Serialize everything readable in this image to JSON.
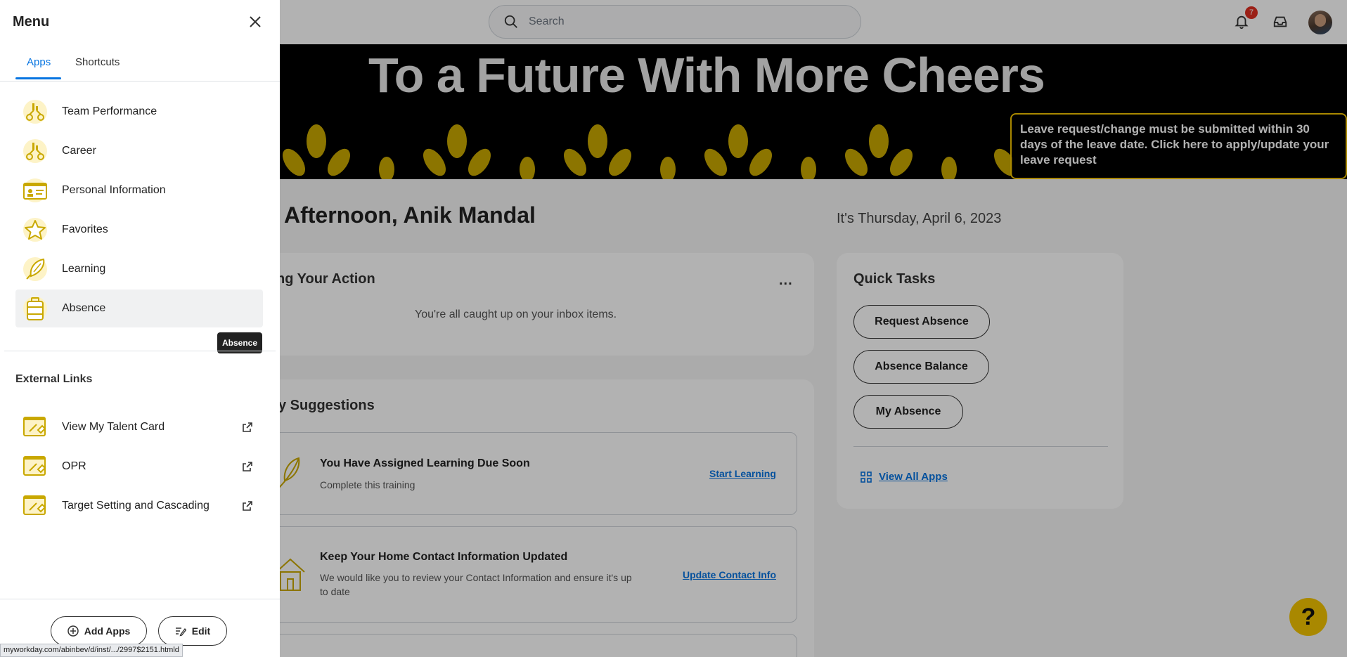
{
  "search": {
    "placeholder": "Search"
  },
  "notifications": {
    "count": "7"
  },
  "banner": {
    "title": "To a Future With More Cheers",
    "notice": "Leave request/change must be submitted within 30 days of the leave date. Click here to apply/update your leave request"
  },
  "greeting": "Afternoon, Anik Mandal",
  "date": "It's Thursday, April 6, 2023",
  "action_card": {
    "title": "ng Your Action",
    "empty_text": "You're all caught up on your inbox items.",
    "more_label": "..."
  },
  "suggestions": {
    "title": "y Suggestions",
    "items": [
      {
        "title": "You Have Assigned Learning Due Soon",
        "desc": "Complete this training",
        "link": "Start Learning"
      },
      {
        "title": "Keep Your Home Contact Information Updated",
        "desc": "We would like you to review your Contact Information and ensure it's up to date",
        "link": "Update Contact Info"
      }
    ]
  },
  "quick_tasks": {
    "title": "Quick Tasks",
    "buttons": [
      "Request Absence",
      "Absence Balance",
      "My Absence"
    ],
    "view_all": "View All Apps"
  },
  "help_label": "?",
  "menu": {
    "title": "Menu",
    "tabs": [
      {
        "label": "Apps",
        "active": true
      },
      {
        "label": "Shortcuts",
        "active": false
      }
    ],
    "apps": [
      {
        "label": "Team Performance",
        "icon": "team-performance-icon"
      },
      {
        "label": "Career",
        "icon": "career-icon"
      },
      {
        "label": "Personal Information",
        "icon": "id-card-icon"
      },
      {
        "label": "Favorites",
        "icon": "star-icon"
      },
      {
        "label": "Learning",
        "icon": "learning-icon"
      },
      {
        "label": "Absence",
        "icon": "suitcase-icon",
        "selected": true
      }
    ],
    "tooltip": "Absence",
    "external_title": "External Links",
    "external_links": [
      {
        "label": "View My Talent Card",
        "icon": "external-app-icon"
      },
      {
        "label": "OPR",
        "icon": "external-app-icon"
      },
      {
        "label": "Target Setting and Cascading",
        "icon": "external-app-icon"
      }
    ],
    "add_apps": "Add Apps",
    "edit": "Edit"
  },
  "status_url": "myworkday.com/abinbev/d/inst/.../2997$2151.htmld",
  "colors": {
    "accent": "#0875e1",
    "brand_yellow": "#f2c300",
    "badge": "#de2e21"
  }
}
